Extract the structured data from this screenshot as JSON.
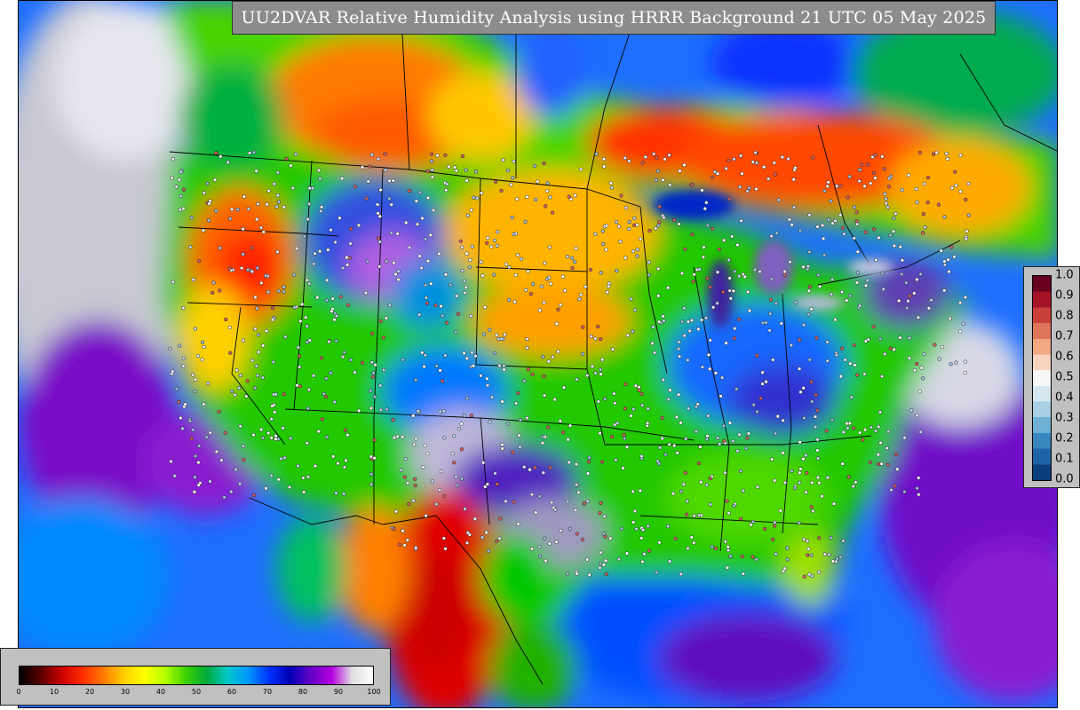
{
  "title": "UU2DVAR Relative Humidity Analysis using HRRR Background 21 UTC 05 May 2025",
  "rh_colorbar": {
    "ticks": [
      "0",
      "10",
      "20",
      "30",
      "40",
      "50",
      "60",
      "70",
      "80",
      "90",
      "100"
    ],
    "stops": [
      "#000000",
      "#5a0000",
      "#c80000",
      "#ff2a00",
      "#ff7800",
      "#ffcc00",
      "#ffff00",
      "#b4ff00",
      "#3cd200",
      "#00aa3c",
      "#00c8c8",
      "#0096ff",
      "#0032ff",
      "#0000b4",
      "#6400c8",
      "#b400dc",
      "#e0e0e0",
      "#ffffff"
    ]
  },
  "bias_colorbar": {
    "ticks": [
      "1.0",
      "0.9",
      "0.8",
      "0.7",
      "0.6",
      "0.5",
      "0.4",
      "0.3",
      "0.2",
      "0.1",
      "0.0"
    ],
    "colors": [
      "#67001f",
      "#a51426",
      "#c9403a",
      "#de7459",
      "#f2a883",
      "#f8d4bf",
      "#f7f7f7",
      "#d4e6f0",
      "#a9cfe4",
      "#6fb1d4",
      "#3a87bf",
      "#1f63a7",
      "#0b3e7d"
    ]
  },
  "chart_data": {
    "type": "heatmap",
    "variable": "Relative Humidity",
    "units": "%",
    "range": [
      0,
      100
    ],
    "background": "HRRR",
    "valid_time": "21 UTC 05 May 2025"
  }
}
